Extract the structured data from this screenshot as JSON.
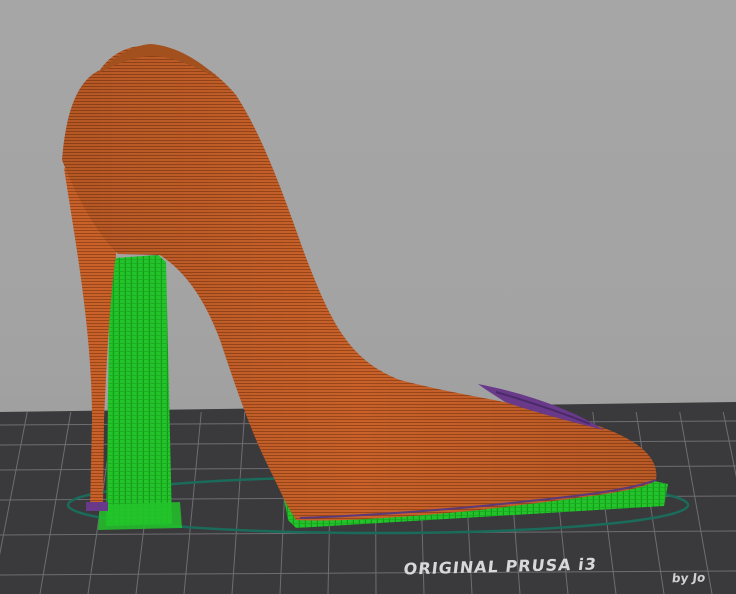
{
  "viewport": {
    "name": "3D print preview viewport",
    "background_color": "#a6a6a6"
  },
  "bed": {
    "logo_text": "ORIGINAL PRUSA i3",
    "logo_subtext": "by Jo",
    "bed_color": "#3a3a3d",
    "grid_color": "#6e6e72"
  },
  "model": {
    "object": "high-heel shoe",
    "perimeter_color": "#c8612a",
    "support_color": "#22c42a",
    "skirt_color": "#1b6b5a",
    "infill_color": "#6a3a8a"
  }
}
